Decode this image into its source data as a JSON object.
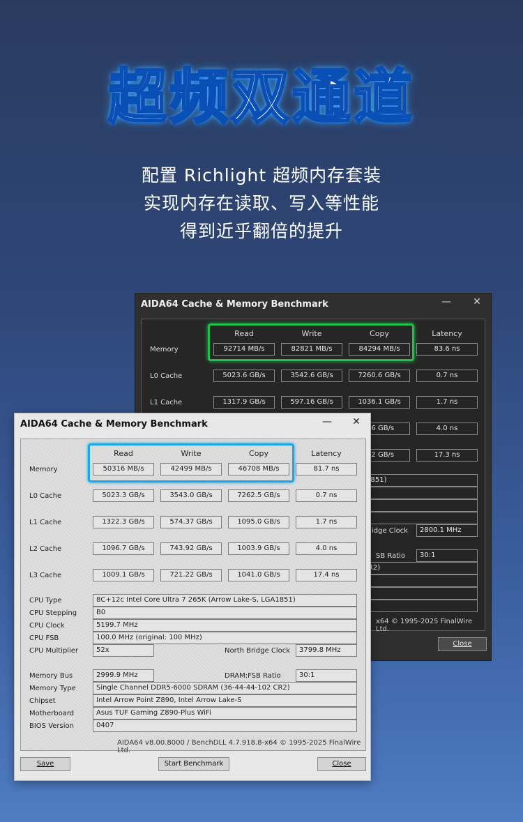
{
  "hero": {
    "title": "超频双通道",
    "line1": "配置 Richlight 超频内存套装",
    "line2": "实现内存在读取、写入等性能",
    "line3": "得到近乎翻倍的提升"
  },
  "colors": {
    "highlight_green": "#1fbf4b",
    "highlight_blue": "#1aa7e8"
  },
  "columns": [
    "Read",
    "Write",
    "Copy",
    "Latency"
  ],
  "dark_window": {
    "title": "AIDA64 Cache & Memory Benchmark",
    "rows": [
      {
        "label": "Memory",
        "read": "92714 MB/s",
        "write": "82821 MB/s",
        "copy": "84294 MB/s",
        "latency": "83.6 ns"
      },
      {
        "label": "L0 Cache",
        "read": "5023.6 GB/s",
        "write": "3542.6 GB/s",
        "copy": "7260.6 GB/s",
        "latency": "0.7 ns"
      },
      {
        "label": "L1 Cache",
        "read": "1317.9 GB/s",
        "write": "597.16 GB/s",
        "copy": "1036.1 GB/s",
        "latency": "1.7 ns"
      },
      {
        "label": "",
        "read": "",
        "write": "",
        "copy": "4.6 GB/s",
        "latency": "4.0 ns"
      },
      {
        "label": "",
        "read": "",
        "write": "",
        "copy": "7.2 GB/s",
        "latency": "17.3 ns"
      }
    ],
    "cpu_type_tail": "LGA1851)",
    "nb_clock_label": "idge Clock",
    "nb_clock_value": "2800.1 MHz",
    "fsb_label": "SB Ratio",
    "fsb_value": "30:1",
    "memtype_tail": "02 CR2)",
    "footer_tail": "x64 © 1995-2025 FinalWire Ltd.",
    "close": "Close"
  },
  "light_window": {
    "title": "AIDA64 Cache & Memory Benchmark",
    "rows": [
      {
        "label": "Memory",
        "read": "50316 MB/s",
        "write": "42499 MB/s",
        "copy": "46708 MB/s",
        "latency": "81.7 ns"
      },
      {
        "label": "L0 Cache",
        "read": "5023.3 GB/s",
        "write": "3543.0 GB/s",
        "copy": "7262.5 GB/s",
        "latency": "0.7 ns"
      },
      {
        "label": "L1 Cache",
        "read": "1322.3 GB/s",
        "write": "574.37 GB/s",
        "copy": "1095.0 GB/s",
        "latency": "1.7 ns"
      },
      {
        "label": "L2 Cache",
        "read": "1096.7 GB/s",
        "write": "743.92 GB/s",
        "copy": "1003.9 GB/s",
        "latency": "4.0 ns"
      },
      {
        "label": "L3 Cache",
        "read": "1009.1 GB/s",
        "write": "721.22 GB/s",
        "copy": "1041.0 GB/s",
        "latency": "17.4 ns"
      }
    ],
    "info": {
      "cpu_type_label": "CPU Type",
      "cpu_type": "8C+12c Intel Core Ultra 7 265K  (Arrow Lake-S, LGA1851)",
      "cpu_stepping_label": "CPU Stepping",
      "cpu_stepping": "B0",
      "cpu_clock_label": "CPU Clock",
      "cpu_clock": "5199.7 MHz",
      "cpu_fsb_label": "CPU FSB",
      "cpu_fsb": "100.0 MHz  (original: 100 MHz)",
      "cpu_mult_label": "CPU Multiplier",
      "cpu_mult": "52x",
      "nb_clock_label": "North Bridge Clock",
      "nb_clock": "3799.8 MHz",
      "mem_bus_label": "Memory Bus",
      "mem_bus": "2999.9 MHz",
      "dram_fsb_label": "DRAM:FSB Ratio",
      "dram_fsb": "30:1",
      "mem_type_label": "Memory Type",
      "mem_type": "Single Channel DDR5-6000 SDRAM  (36-44-44-102 CR2)",
      "chipset_label": "Chipset",
      "chipset": "Intel Arrow Point Z890, Intel Arrow Lake-S",
      "mobo_label": "Motherboard",
      "mobo": "Asus TUF Gaming Z890-Plus WiFi",
      "bios_label": "BIOS Version",
      "bios": "0407"
    },
    "footer": "AIDA64 v8.00.8000 / BenchDLL 4.7.918.8-x64 © 1995-2025 FinalWire Ltd.",
    "save": "Save",
    "start": "Start Benchmark",
    "close": "Close"
  }
}
